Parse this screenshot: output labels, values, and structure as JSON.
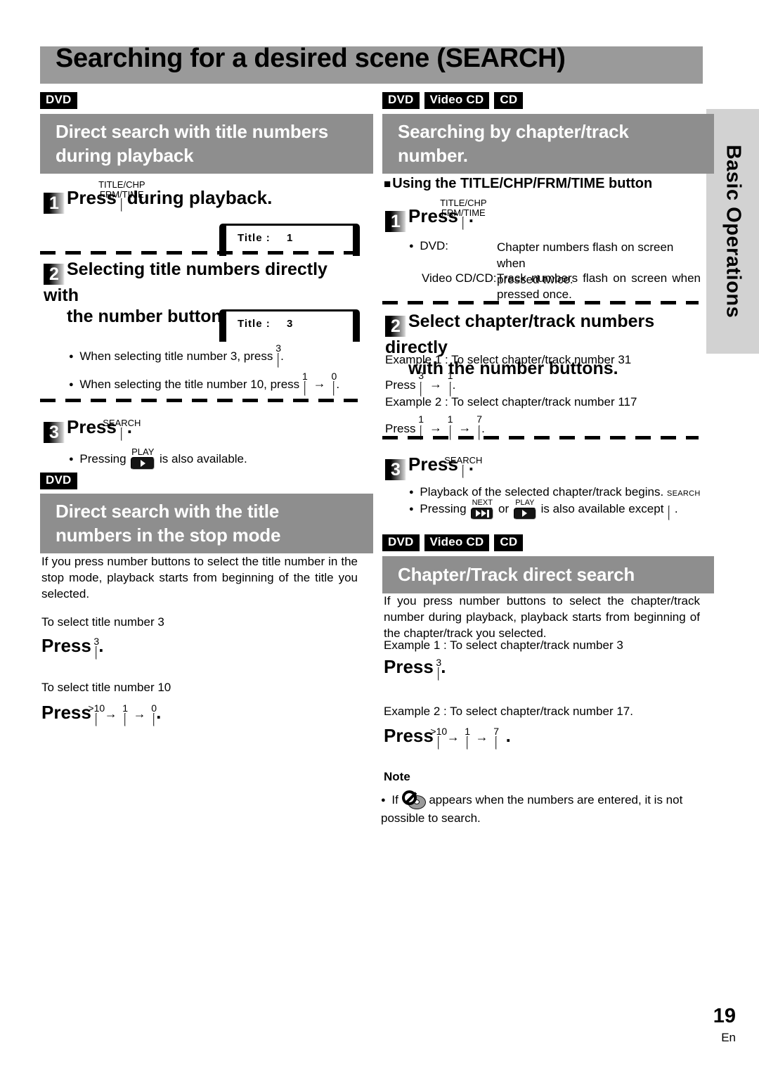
{
  "page": {
    "title": "Searching for a desired scene (SEARCH)",
    "side_tab_label": "Basic Operations",
    "number": "19",
    "language_code": "En"
  },
  "media_badges": {
    "dvd": "DVD",
    "video_cd": "Video CD",
    "cd": "CD"
  },
  "left_column": {
    "section1": {
      "badges": [
        "DVD"
      ],
      "heading_line1": "Direct search with title numbers",
      "heading_line2": "during playback",
      "step1": {
        "num": "1",
        "press_label": "Press",
        "button_cap_line1": "TITLE/CHP",
        "button_cap_line2": "FRM/TIME",
        "after_text": "during playback.",
        "display": {
          "label": "Title :",
          "value": "1"
        }
      },
      "step2": {
        "num": "2",
        "text_line1": "Selecting title numbers directly with",
        "text_line2": "the number buttons.",
        "display": {
          "label": "Title :",
          "value": "3"
        },
        "bullet1_before": "When selecting title number 3, press",
        "bullet1_key": "3",
        "bullet1_after": ".",
        "bullet2_before": "When selecting the title number 10, press",
        "bullet2_key1": "1",
        "bullet2_key2": "0",
        "bullet2_after": "."
      },
      "step3": {
        "num": "3",
        "press_label": "Press",
        "button_cap": "SEARCH",
        "after_text": ".",
        "bullet_before": "Pressing",
        "bullet_button_cap": "PLAY",
        "bullet_after": "is also available."
      }
    },
    "section2": {
      "badges": [
        "DVD"
      ],
      "heading_line1": "Direct search with the title",
      "heading_line2": "numbers in the stop mode",
      "paragraph": "If you press number buttons to select the title number in the stop mode, playback starts from beginning of the title you selected.",
      "example1_label": "To select title number 3",
      "example1_press": "Press",
      "example1_key": "3",
      "example1_after": ".",
      "example2_label": "To select title number 10",
      "example2_press": "Press",
      "example2_key1": ">10",
      "example2_key2": "1",
      "example2_key3": "0",
      "example2_after": "."
    }
  },
  "right_column": {
    "section1": {
      "badges": [
        "DVD",
        "Video CD",
        "CD"
      ],
      "heading_line1": "Searching by chapter/track",
      "heading_line2": "number.",
      "subheading": "Using the TITLE/CHP/FRM/TIME button",
      "step1": {
        "num": "1",
        "press_label": "Press",
        "button_cap_line1": "TITLE/CHP",
        "button_cap_line2": "FRM/TIME",
        "after_text": ".",
        "rows": [
          {
            "term": "DVD:",
            "desc_line1": "Chapter numbers flash on screen when",
            "desc_line2": "pressed twice."
          },
          {
            "term": "Video CD/CD:",
            "desc_line1": "Track numbers flash on screen when",
            "desc_line2": "pressed once."
          }
        ]
      },
      "step2": {
        "num": "2",
        "text_line1": "Select chapter/track numbers directly",
        "text_line2": "with the number buttons.",
        "example1_label": "Example 1 : To select chapter/track number 31",
        "example1_press": "Press",
        "example1_key1": "3",
        "example1_key2": "1",
        "example1_after": ".",
        "example2_label": "Example 2 : To select chapter/track number 117",
        "example2_press": "Press",
        "example2_key1": "1",
        "example2_key2": "1",
        "example2_key3": "7",
        "example2_after": "."
      },
      "step3": {
        "num": "3",
        "press_label": "Press",
        "button_cap": "SEARCH",
        "after_text": ".",
        "bullet1": "Playback of the selected chapter/track begins.",
        "bullet1_trailing_cap": "SEARCH",
        "bullet2_before": "Pressing",
        "bullet2_cap1": "NEXT",
        "bullet2_mid": "or",
        "bullet2_cap2": "PLAY",
        "bullet2_after": "is also available except",
        "bullet2_end": "."
      }
    },
    "section2": {
      "badges": [
        "DVD",
        "Video CD",
        "CD"
      ],
      "heading": "Chapter/Track direct search",
      "paragraph": "If you press number buttons to select the chapter/track number during playback, playback starts from beginning of the chapter/track you selected.",
      "example1_label": "Example 1 : To select chapter/track number 3",
      "example1_press": "Press",
      "example1_key": "3",
      "example1_after": ".",
      "example2_label": "Example 2 : To select chapter/track number 17.",
      "example2_press": "Press",
      "example2_key1": ">10",
      "example2_key2": "1",
      "example2_key3": "7",
      "example2_after": "."
    },
    "note": {
      "title": "Note",
      "text_before_icon": "If",
      "icon_name": "no-disc-icon",
      "text_after_icon": "appears when the numbers are entered, it is not possible to search."
    }
  }
}
